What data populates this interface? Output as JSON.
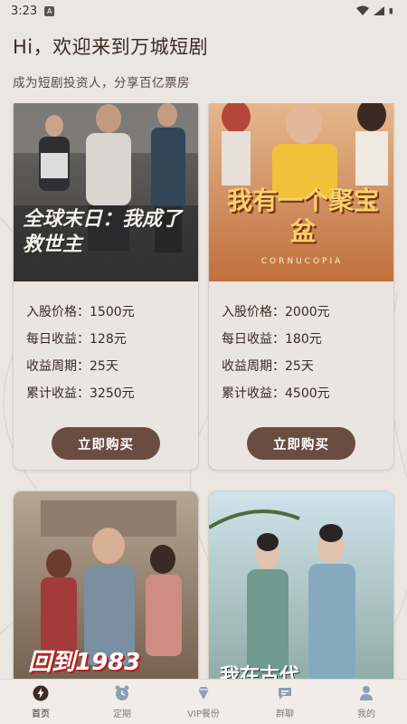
{
  "status_bar": {
    "time": "3:23",
    "notif": "A"
  },
  "header": {
    "greeting": "Hi，欢迎来到万城短剧",
    "subtitle": "成为短剧投资人，分享百亿票房"
  },
  "cards": [
    {
      "poster_title": "全球末日：我成了救世主",
      "rows": [
        {
          "label": "入股价格：",
          "value": "1500元"
        },
        {
          "label": "每日收益：",
          "value": "128元"
        },
        {
          "label": "收益周期：",
          "value": "25天"
        },
        {
          "label": "累计收益：",
          "value": "3250元"
        }
      ],
      "button": "立即购买"
    },
    {
      "poster_title": "我有一个聚宝盆",
      "poster_sub": "CORNUCOPIA",
      "rows": [
        {
          "label": "入股价格：",
          "value": "2000元"
        },
        {
          "label": "每日收益：",
          "value": "180元"
        },
        {
          "label": "收益周期：",
          "value": "25天"
        },
        {
          "label": "累计收益：",
          "value": "4500元"
        }
      ],
      "button": "立即购买"
    },
    {
      "poster_title": "回到1983"
    },
    {
      "poster_title": "我在古代"
    }
  ],
  "tabs": [
    {
      "label": "首页",
      "icon": "lightning-icon",
      "active": true
    },
    {
      "label": "定期",
      "icon": "alarm-clock-icon",
      "active": false
    },
    {
      "label": "VIP餐份",
      "icon": "diamond-icon",
      "active": false
    },
    {
      "label": "群聊",
      "icon": "chat-icon",
      "active": false
    },
    {
      "label": "我的",
      "icon": "user-icon",
      "active": false
    }
  ],
  "colors": {
    "background": "#ebe6e2",
    "button": "#6b4c40",
    "text": "#3a2a22"
  }
}
